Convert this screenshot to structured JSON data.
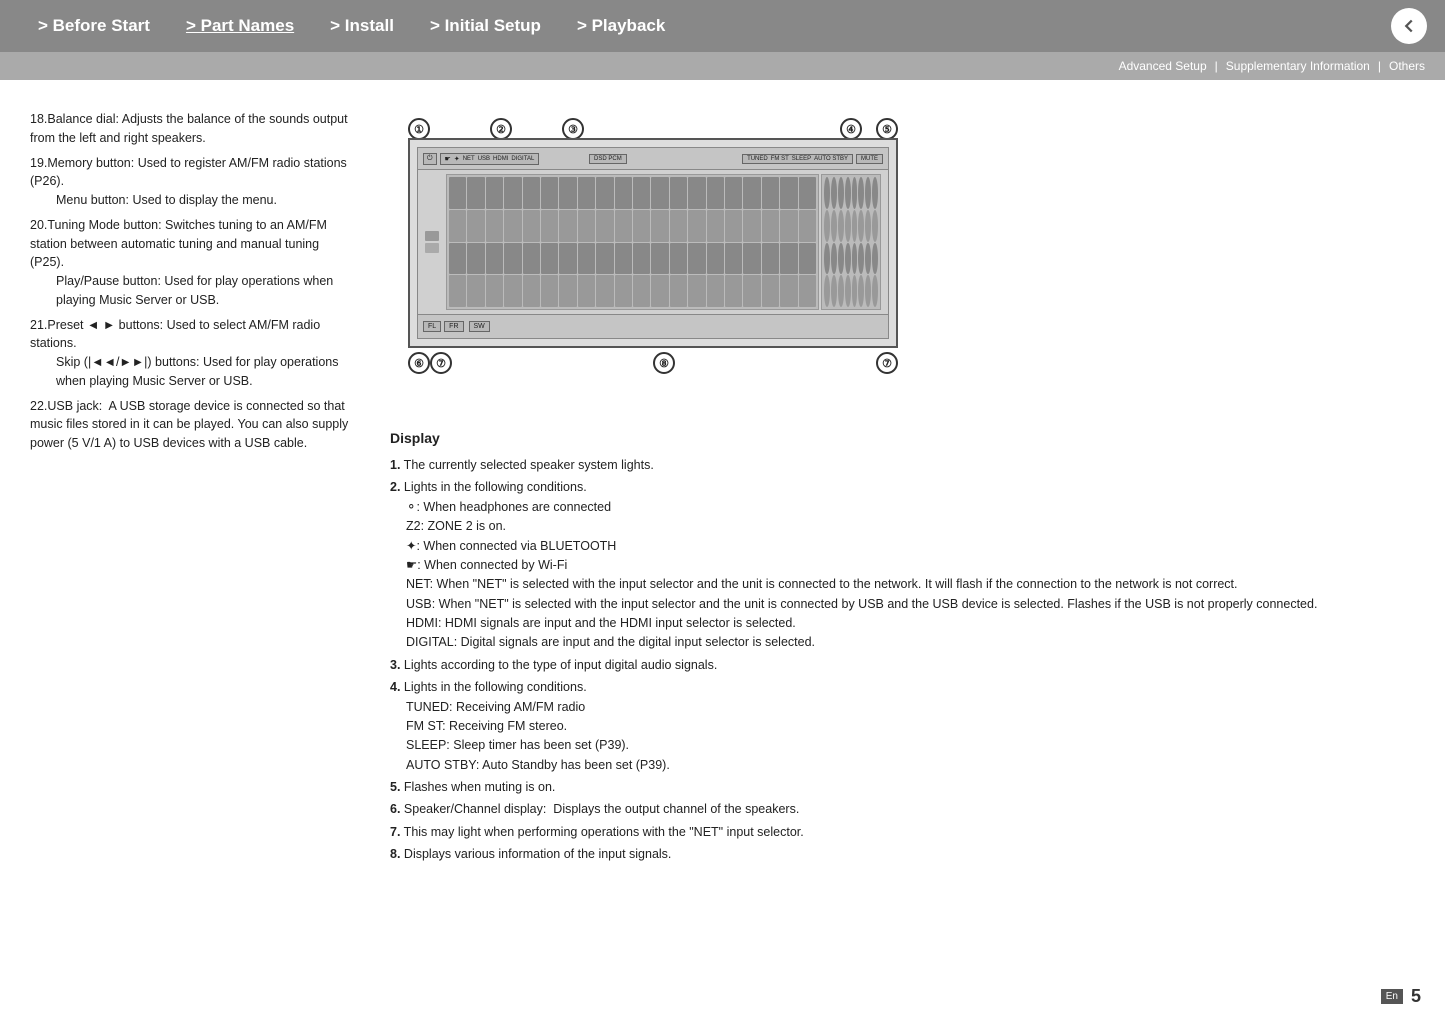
{
  "nav": {
    "items": [
      {
        "label": "> Before Start",
        "active": false
      },
      {
        "label": "> Part Names",
        "active": true
      },
      {
        "label": "> Install",
        "active": false
      },
      {
        "label": "> Initial Setup",
        "active": false
      },
      {
        "label": "> Playback",
        "active": false
      }
    ],
    "back_label": "↩"
  },
  "secondary_nav": {
    "items": [
      "Advanced Setup",
      "Supplementary Information",
      "Others"
    ],
    "separator": "|"
  },
  "left_col": {
    "items": [
      {
        "num": "18.",
        "text": "Balance dial: Adjusts the balance of the sounds output from the left and right speakers."
      },
      {
        "num": "19.",
        "text": "Memory button: Used to register AM/FM radio stations (P26).",
        "sub": "Menu button: Used to display the menu."
      },
      {
        "num": "20.",
        "text": "Tuning Mode button: Switches tuning to an AM/FM station between automatic tuning and manual tuning (P25).",
        "sub": "Play/Pause button: Used for play operations when playing Music Server or USB."
      },
      {
        "num": "21.",
        "text": "Preset ◄ ► buttons: Used to select AM/FM radio stations.",
        "sub": "Skip (|◄◄/►►|) buttons: Used for play operations when playing Music Server or USB."
      },
      {
        "num": "22.",
        "text": "USB jack:  A USB storage device is connected so that music files stored in it can be played. You can also supply power (5 V/1 A) to USB devices with a USB cable."
      }
    ]
  },
  "diagram": {
    "callouts": [
      "①",
      "②",
      "③",
      "④",
      "⑤",
      "⑥",
      "⑦",
      "⑧",
      "⑦"
    ],
    "indicators": [
      "NET",
      "USB",
      "HDMI",
      "DIGITAL",
      "DSD",
      "PCM",
      "TUNED",
      "FM ST",
      "SLEEP",
      "AUTO STBY",
      "MUTE"
    ],
    "channels": [
      "FL",
      "FR",
      "SW"
    ]
  },
  "display_section": {
    "title": "Display",
    "items": [
      {
        "num": "1.",
        "text": "The currently selected speaker system lights."
      },
      {
        "num": "2.",
        "text": "Lights in the following conditions.",
        "subs": [
          "♡: When headphones are connected",
          "Z2: ZONE 2 is on.",
          "✦: When connected via BLUETOOTH",
          "☛: When connected by Wi-Fi",
          "NET: When \"NET\" is selected with the input selector and the unit is connected to the network. It will flash if the connection to the network is not correct.",
          "USB: When \"NET\" is selected with the input selector and the unit is connected by USB and the USB device is selected. Flashes if the USB is not properly connected.",
          "HDMI: HDMI signals are input and the HDMI input selector is selected.",
          "DIGITAL: Digital signals are input and the digital input selector is selected."
        ]
      },
      {
        "num": "3.",
        "text": "Lights according to the type of input digital audio signals."
      },
      {
        "num": "4.",
        "text": "Lights in the following conditions.",
        "subs": [
          "TUNED: Receiving AM/FM radio",
          "FM ST: Receiving FM stereo.",
          "SLEEP: Sleep timer has been set (P39).",
          "AUTO STBY: Auto Standby has been set (P39)."
        ]
      },
      {
        "num": "5.",
        "text": "Flashes when muting is on."
      },
      {
        "num": "6.",
        "text": "Speaker/Channel display:  Displays the output channel of the speakers."
      },
      {
        "num": "7.",
        "text": "This may light when performing operations with the \"NET\" input selector."
      },
      {
        "num": "8.",
        "text": "Displays various information of the input signals."
      }
    ]
  },
  "page": {
    "lang_badge": "En",
    "number": "5"
  }
}
